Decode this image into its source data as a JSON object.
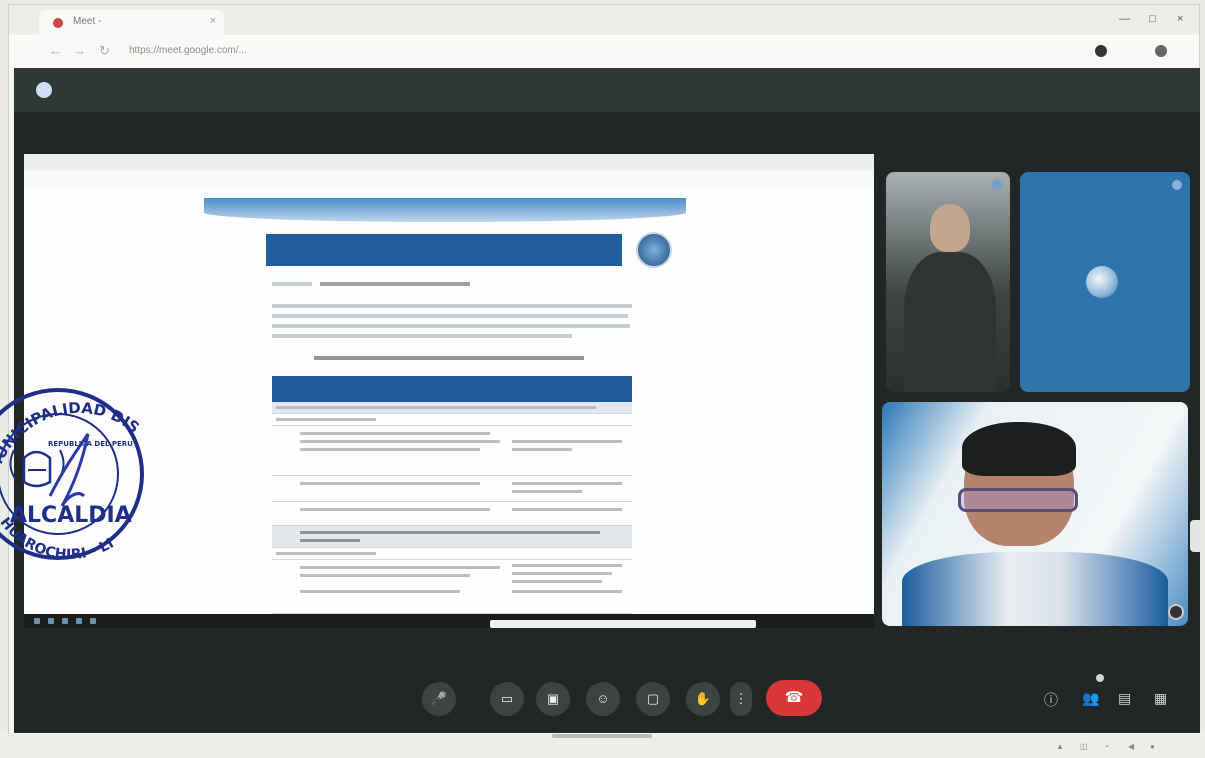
{
  "browser": {
    "tab_title": "Meet - ",
    "tab_close": "×",
    "url": "https://meet.google.com/...",
    "controls": {
      "minimize": "—",
      "maximize": "□",
      "close": "×"
    },
    "nav": {
      "back": "←",
      "forward": "→",
      "reload": "↻"
    }
  },
  "meet": {
    "header_title": "",
    "presentation": {
      "table_head": {
        "col1": "",
        "col2": ""
      }
    },
    "tiles": [
      {
        "name": ""
      },
      {
        "name": ""
      },
      {
        "name": ""
      }
    ],
    "controls": {
      "time": "",
      "meeting_code": "",
      "mic_icon": "mic-icon",
      "camera_icon": "camera-icon",
      "captions_icon": "captions-icon",
      "emoji_icon": "emoji-icon",
      "present_icon": "present-icon",
      "raise_hand_icon": "raise-hand-icon",
      "more_icon": "more-vert-icon",
      "hangup_icon": "call-end-icon",
      "info_icon": "info-icon",
      "people_icon": "people-icon",
      "chat_icon": "chat-icon",
      "activities_icon": "activities-icon"
    }
  },
  "stamp": {
    "top_text": "MUNICIPALIDAD DISTRITAL DE SANTIAGO DE TUNA",
    "inner_text": "REPUBLICA DEL PERU",
    "center_text": "ALCALDIA",
    "bottom_text": "HUAROCHIRI - LIMA"
  }
}
